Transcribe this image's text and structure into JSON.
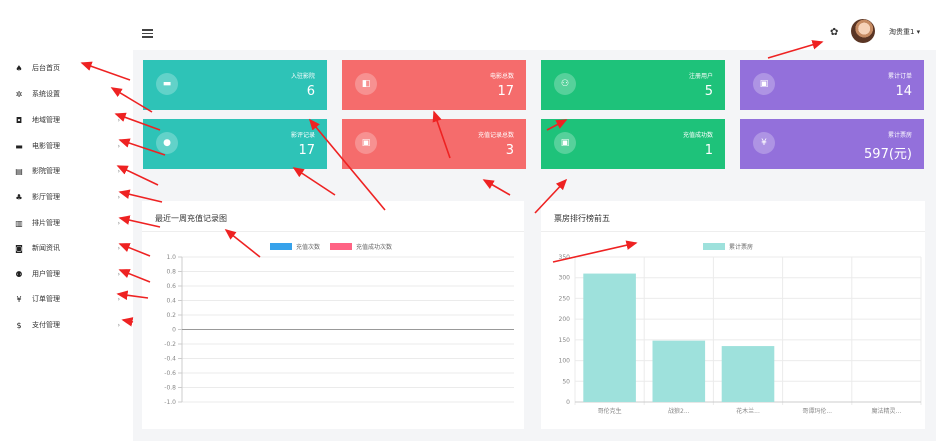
{
  "sidebar": {
    "items": [
      {
        "label": "后台首页",
        "icon": "home-icon",
        "glyph": "♠",
        "arrow": ""
      },
      {
        "label": "系统设置",
        "icon": "gear-icon",
        "glyph": "✲",
        "arrow": "›"
      },
      {
        "label": "地域管理",
        "icon": "map-icon",
        "glyph": "◘",
        "arrow": "›"
      },
      {
        "label": "电影管理",
        "icon": "film-icon",
        "glyph": "▬",
        "arrow": "›"
      },
      {
        "label": "影院管理",
        "icon": "building-icon",
        "glyph": "▤",
        "arrow": "›"
      },
      {
        "label": "影厅管理",
        "icon": "seat-icon",
        "glyph": "♣",
        "arrow": "›"
      },
      {
        "label": "排片管理",
        "icon": "schedule-icon",
        "glyph": "▥",
        "arrow": "›"
      },
      {
        "label": "新闻资讯",
        "icon": "news-icon",
        "glyph": "◙",
        "arrow": "›"
      },
      {
        "label": "用户管理",
        "icon": "users-icon",
        "glyph": "⚉",
        "arrow": "›"
      },
      {
        "label": "订单管理",
        "icon": "yen-icon",
        "glyph": "¥",
        "arrow": "›"
      },
      {
        "label": "支付管理",
        "icon": "dollar-icon",
        "glyph": "$",
        "arrow": "›"
      }
    ]
  },
  "header": {
    "menu_icon": "hamburger-menu-icon",
    "theme_icon": "palette-icon",
    "theme_glyph": "✿",
    "username": "淘贵重1 ▾"
  },
  "stats": [
    {
      "title": "入驻影院",
      "value": "6",
      "icon": "cinema-icon",
      "glyph": "▬",
      "color": "#2ec3b7"
    },
    {
      "title": "电影总数",
      "value": "17",
      "icon": "film-reel-icon",
      "glyph": "◧",
      "color": "#f56c6c"
    },
    {
      "title": "注册用户",
      "value": "5",
      "icon": "users-icon",
      "glyph": "⚇",
      "color": "#1ec27a"
    },
    {
      "title": "累计订单",
      "value": "14",
      "icon": "order-icon",
      "glyph": "▣",
      "color": "#9370db"
    },
    {
      "title": "影评记录",
      "value": "17",
      "icon": "location-icon",
      "glyph": "●",
      "color": "#2ec3b7"
    },
    {
      "title": "充值记录总数",
      "value": "3",
      "icon": "recharge-icon",
      "glyph": "▣",
      "color": "#f56c6c"
    },
    {
      "title": "充值成功数",
      "value": "1",
      "icon": "success-icon",
      "glyph": "▣",
      "color": "#1ec27a"
    },
    {
      "title": "累计票房",
      "value": "597(元)",
      "icon": "yen-icon",
      "glyph": "¥",
      "color": "#9370db"
    }
  ],
  "line_panel": {
    "title": "最近一周充值记录图",
    "chart_data": {
      "type": "line",
      "legend": [
        "充值次数",
        "充值成功次数"
      ],
      "legend_colors": [
        "#36a2eb",
        "#ff6384"
      ],
      "ylim": [
        -1.0,
        1.0
      ],
      "yticks": [
        "1.0",
        "0.8",
        "0.6",
        "0.4",
        "0.2",
        "0",
        "-0.2",
        "-0.4",
        "-0.6",
        "-0.8",
        "-1.0"
      ],
      "grid": true,
      "legend_position": "top-center",
      "series": [
        {
          "name": "充值次数",
          "values": []
        },
        {
          "name": "充值成功次数",
          "values": []
        }
      ]
    }
  },
  "bar_panel": {
    "title": "票房排行榜前五",
    "chart_data": {
      "type": "bar",
      "legend": [
        "累计票房"
      ],
      "bar_color": "#9ee1dc",
      "categories": [
        "哥伦克生",
        "战狼2...",
        "花木兰...",
        "哥谭玛伦...",
        "魔法精灵..."
      ],
      "values": [
        310,
        148,
        135,
        0,
        0
      ],
      "ylim": [
        0,
        350
      ],
      "yticks": [
        "350",
        "300",
        "250",
        "200",
        "150",
        "100",
        "50",
        "0"
      ],
      "grid": true,
      "legend_position": "top-center"
    }
  }
}
